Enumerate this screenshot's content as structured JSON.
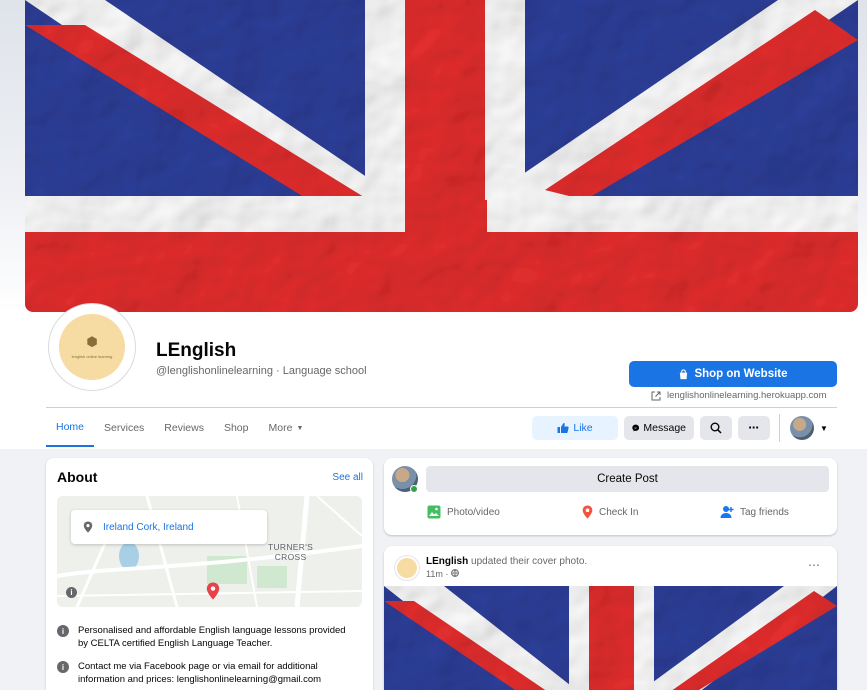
{
  "page": {
    "name": "LEnglish",
    "subtitle": "@lenglishonlinelearning · Language school",
    "avatar_caption": "lenglish online learning"
  },
  "header": {
    "shop_button": "Shop on Website",
    "website": "lenglishonlinelearning.herokuapp.com"
  },
  "tabs": [
    {
      "label": "Home",
      "active": true
    },
    {
      "label": "Services"
    },
    {
      "label": "Reviews"
    },
    {
      "label": "Shop"
    },
    {
      "label": "More"
    }
  ],
  "actions": {
    "like": "Like",
    "message": "Message"
  },
  "about": {
    "title": "About",
    "see_all": "See all",
    "location": "Ireland Cork, Ireland",
    "map_label_line1": "TURNER'S",
    "map_label_line2": "CROSS",
    "description": "Personalised and affordable English language lessons provided by CELTA certified English Language Teacher.",
    "contact": "Contact me via Facebook page or via email for additional information and prices: lenglishonlinelearning@gmail.com"
  },
  "composer": {
    "create_post": "Create Post",
    "photo_video": "Photo/video",
    "check_in": "Check In",
    "tag_friends": "Tag friends"
  },
  "post": {
    "author": "LEnglish",
    "action": "updated their cover photo.",
    "time": "11m ·"
  },
  "colors": {
    "accent": "#1b74e4",
    "flag_blue": "#2a3a8f",
    "flag_red": "#d42a2a",
    "background": "#f0f2f5"
  }
}
